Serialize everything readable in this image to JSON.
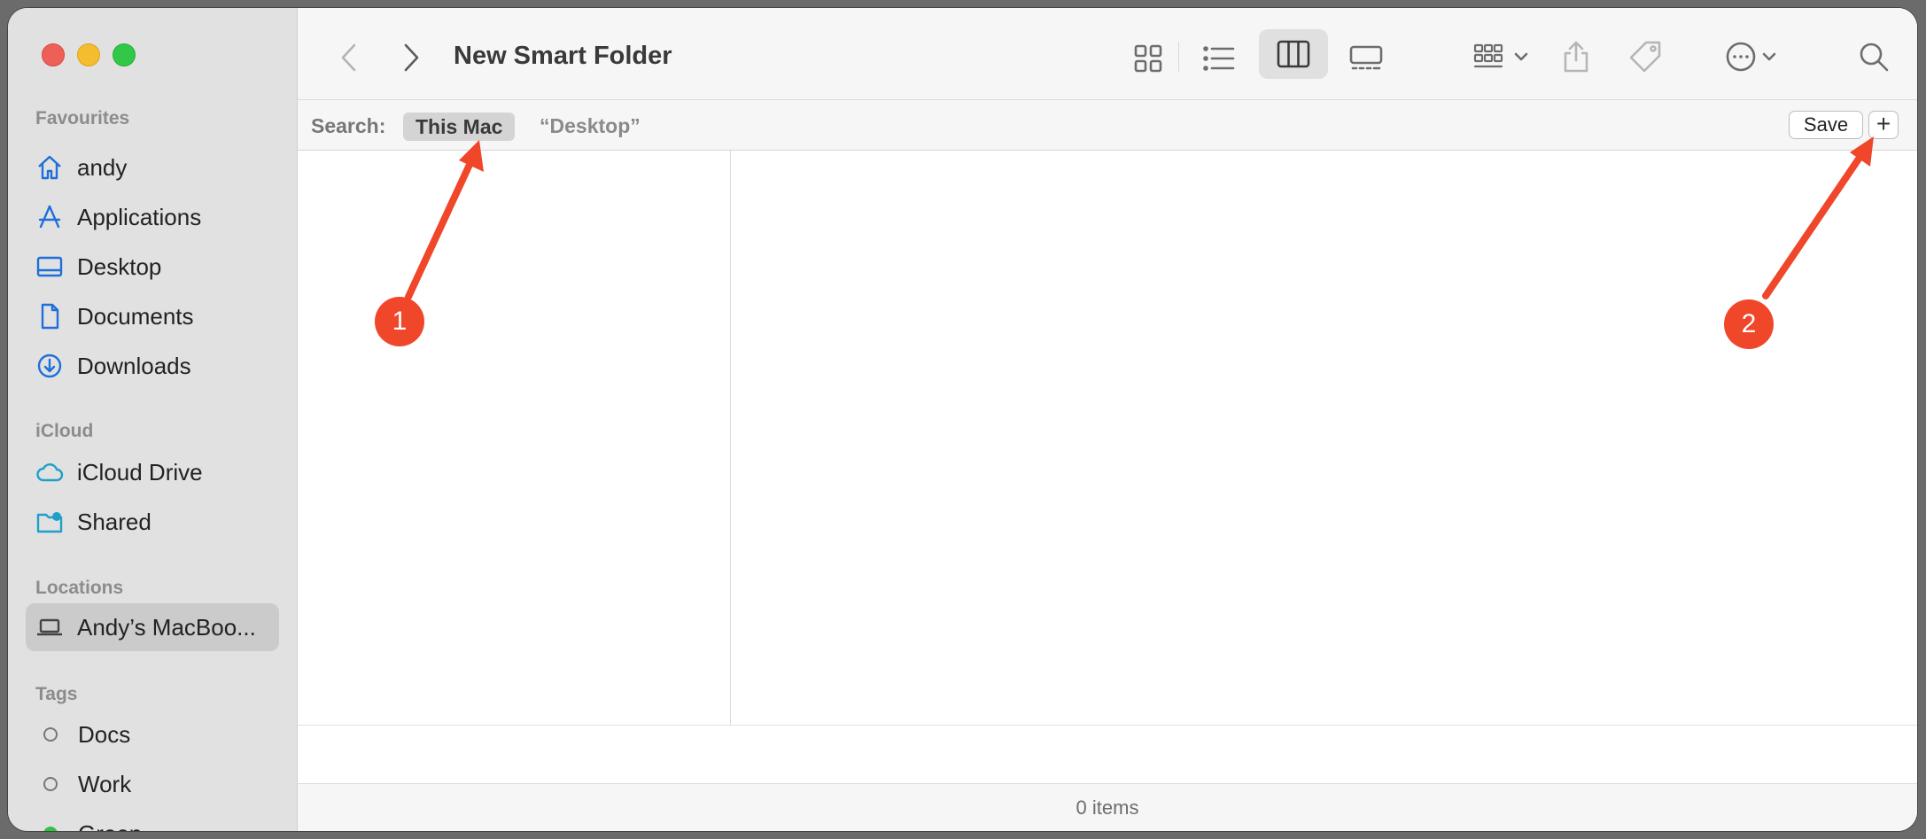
{
  "window": {
    "title": "New Smart Folder"
  },
  "sidebar": {
    "sections": [
      {
        "header": "Favourites",
        "items": [
          {
            "label": "andy",
            "icon": "home-icon"
          },
          {
            "label": "Applications",
            "icon": "applications-icon"
          },
          {
            "label": "Desktop",
            "icon": "desktop-icon"
          },
          {
            "label": "Documents",
            "icon": "document-icon"
          },
          {
            "label": "Downloads",
            "icon": "download-icon"
          }
        ]
      },
      {
        "header": "iCloud",
        "items": [
          {
            "label": "iCloud Drive",
            "icon": "cloud-icon"
          },
          {
            "label": "Shared",
            "icon": "shared-folder-icon"
          }
        ]
      },
      {
        "header": "Locations",
        "items": [
          {
            "label": "Andy’s MacBoo...",
            "icon": "laptop-icon",
            "selected": true
          }
        ]
      },
      {
        "header": "Tags",
        "items": [
          {
            "label": "Docs",
            "icon": "tag-circle-icon"
          },
          {
            "label": "Work",
            "icon": "tag-circle-icon"
          },
          {
            "label": "Green",
            "icon": "tag-green-icon",
            "color": "#2fc441"
          }
        ]
      }
    ]
  },
  "search": {
    "label": "Search:",
    "scopes": [
      "This Mac",
      "“Desktop”"
    ],
    "active_scope": "This Mac",
    "save_label": "Save",
    "add_label": "+"
  },
  "status": {
    "items_text": "0 items"
  },
  "annotations": [
    {
      "number": "1",
      "color": "#f0462a"
    },
    {
      "number": "2",
      "color": "#f0462a"
    }
  ],
  "colors": {
    "accent": "#1e6fd9",
    "annotation": "#f0462a",
    "sidebar_bg": "#e1e1e1"
  }
}
